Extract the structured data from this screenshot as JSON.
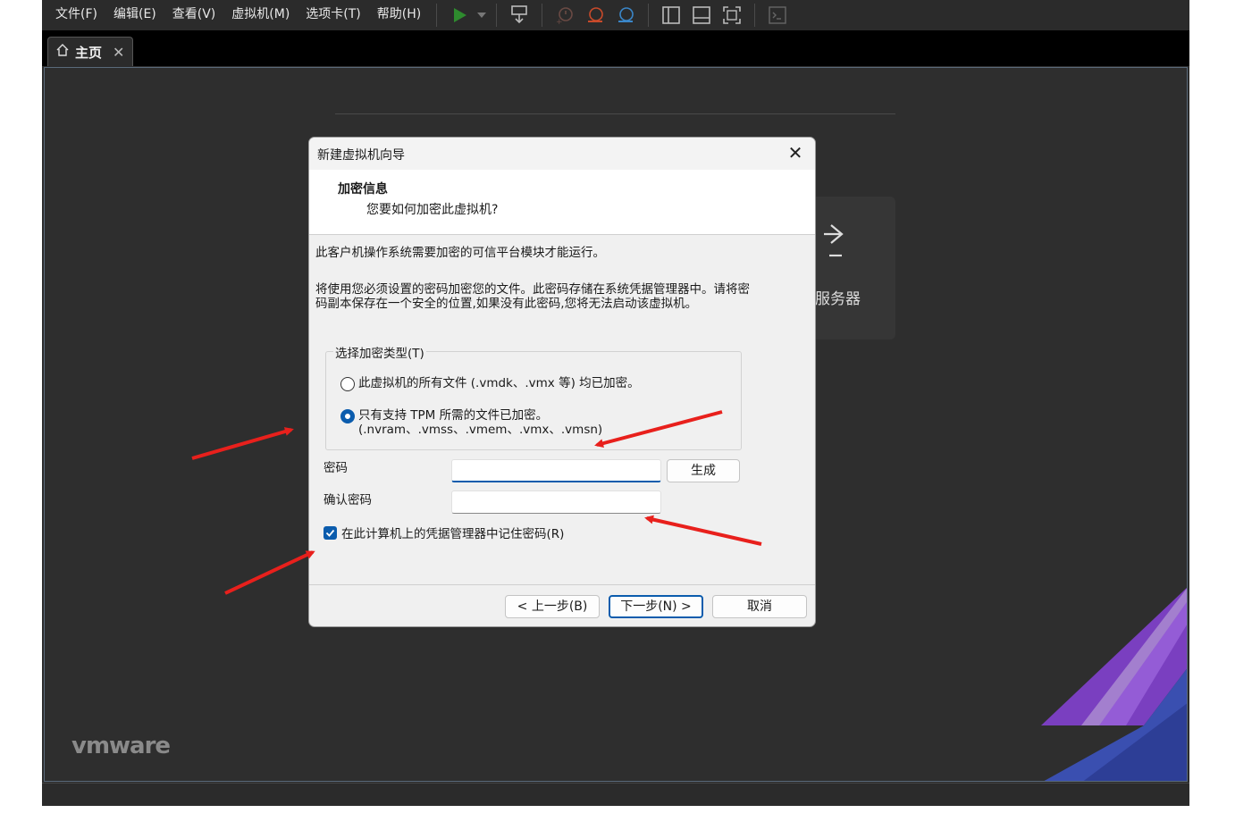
{
  "menubar": {
    "items": [
      "文件(F)",
      "编辑(E)",
      "查看(V)",
      "虚拟机(M)",
      "选项卡(T)",
      "帮助(H)"
    ]
  },
  "toolbar": {
    "icons": [
      "play-icon",
      "dropdown-icon",
      "network-icon",
      "snapshot-icon",
      "revert-snapshot-icon",
      "manage-snapshot-icon",
      "sidebar-layout-icon",
      "bottom-layout-icon",
      "fullscreen-icon",
      "console-icon"
    ],
    "play_color": "#2e8b2e"
  },
  "tabs": [
    {
      "label": "主页",
      "icon": "home-icon",
      "closable": true
    }
  ],
  "home": {
    "server_label": "服务器",
    "logo": "vmware"
  },
  "dialog": {
    "title": "新建虚拟机向导",
    "header_title": "加密信息",
    "header_subtitle": "您要如何加密此虚拟机?",
    "message1": "此客户机操作系统需要加密的可信平台模块才能运行。",
    "message2": "将使用您必须设置的密码加密您的文件。此密码存储在系统凭据管理器中。请将密码副本保存在一个安全的位置,如果没有此密码,您将无法启动该虚拟机。",
    "group_label": "选择加密类型(T)",
    "radio_all": "此虚拟机的所有文件 (.vmdk、.vmx 等) 均已加密。",
    "radio_tpm": "只有支持 TPM 所需的文件已加密。(.nvram、.vmss、.vmem、.vmx、.vmsn)",
    "selected_option": "radio_tpm",
    "password_label": "密码",
    "password_value": "",
    "confirm_label": "确认密码",
    "confirm_value": "",
    "generate_button": "生成",
    "remember_label": "在此计算机上的凭据管理器中记住密码(R)",
    "remember_checked": true,
    "back_button": "< 上一步(B)",
    "next_button": "下一步(N) >",
    "cancel_button": "取消",
    "accent_color": "#0b5cad"
  },
  "annotation_color": "#e8201c"
}
